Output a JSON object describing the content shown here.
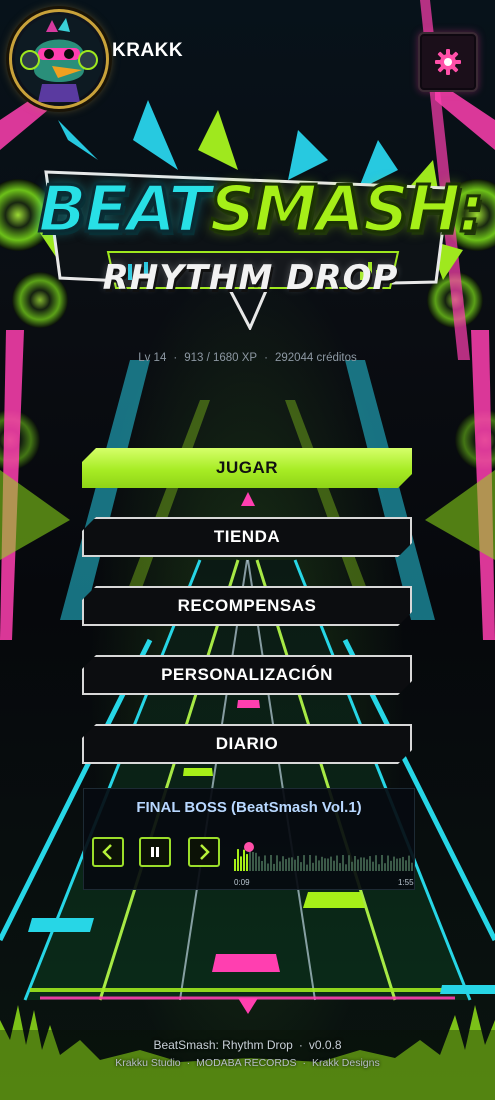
{
  "player": {
    "name": "KRAKK"
  },
  "stats": {
    "level": "Lv 14",
    "xp": "913 / 1680 XP",
    "credits": "292044 créditos"
  },
  "logo": {
    "line1_a": "BEAT",
    "line1_b": "SMASH:",
    "line2": "RHYTHM DROP"
  },
  "menu": [
    {
      "label": "JUGAR",
      "selected": true
    },
    {
      "label": "TIENDA",
      "selected": false
    },
    {
      "label": "RECOMPENSAS",
      "selected": false
    },
    {
      "label": "PERSONALIZACIÓN",
      "selected": false
    },
    {
      "label": "DIARIO",
      "selected": false
    }
  ],
  "music": {
    "title": "FINAL BOSS (BeatSmash Vol.1)",
    "elapsed": "0:09",
    "duration": "1:55",
    "progress": 0.08,
    "prev_icon": "chevron-left-icon",
    "pause_icon": "pause-icon",
    "next_icon": "chevron-right-icon"
  },
  "footer": {
    "game": "BeatSmash: Rhythm Drop",
    "version": "v0.0.8",
    "credits": [
      "Krakku Studio",
      "MODABA RECORDS",
      "Krakk Designs"
    ]
  },
  "colors": {
    "accent_green": "#a6ef18",
    "accent_cyan": "#28e0e6",
    "accent_pink": "#ff3fb0",
    "settings_icon": "#ff4fa8"
  },
  "icons": {
    "settings": "gear-icon",
    "avatar": "duck-avatar"
  }
}
